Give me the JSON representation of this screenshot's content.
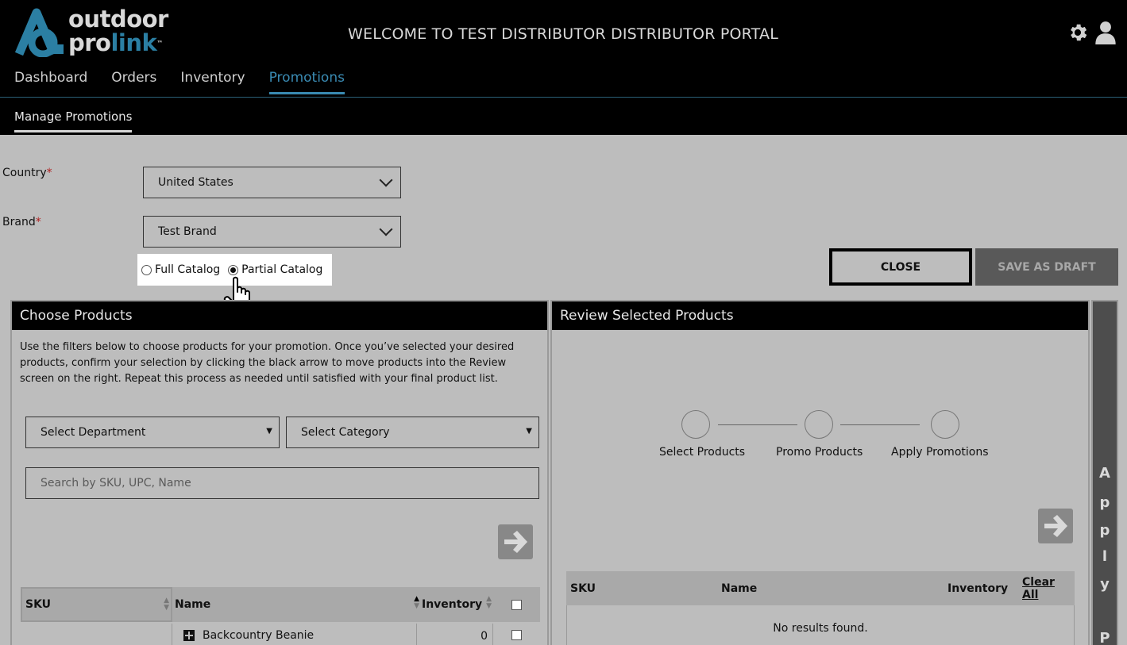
{
  "header": {
    "logo_line1": "outdoor",
    "logo_line2a": "pro",
    "logo_line2b": "link",
    "logo_tm": "™",
    "title": "WELCOME TO TEST DISTRIBUTOR DISTRIBUTOR PORTAL",
    "icons": [
      "gear-icon",
      "user-icon"
    ]
  },
  "nav": {
    "items": [
      {
        "label": "Dashboard",
        "active": false
      },
      {
        "label": "Orders",
        "active": false
      },
      {
        "label": "Inventory",
        "active": false
      },
      {
        "label": "Promotions",
        "active": true
      }
    ]
  },
  "subnav": {
    "label": "Manage Promotions"
  },
  "form": {
    "country_label": "Country",
    "brand_label": "Brand",
    "required_mark": "*",
    "country_value": "United States",
    "brand_value": "Test Brand",
    "catalog_options": [
      {
        "label": "Full Catalog",
        "checked": false
      },
      {
        "label": "Partial Catalog",
        "checked": true
      }
    ]
  },
  "actions": {
    "close_label": "CLOSE",
    "save_draft_label": "SAVE AS DRAFT"
  },
  "choose": {
    "title": "Choose Products",
    "description": "Use the filters below to choose products for your promotion. Once you’ve selected your desired products, confirm your selection by clicking the black arrow to move products into the Review screen on the right. Repeat this process as needed until satisfied with your final product list.",
    "department_placeholder": "Select Department",
    "category_placeholder": "Select Category",
    "search_placeholder": "Search by SKU, UPC, Name",
    "columns": {
      "sku": "SKU",
      "name": "Name",
      "inventory": "Inventory"
    },
    "rows": [
      {
        "sku": "",
        "name": "Backcountry Beanie",
        "inventory": "0"
      }
    ]
  },
  "review": {
    "title": "Review Selected Products",
    "steps": [
      "Select Products",
      "Promo Products",
      "Apply Promotions"
    ],
    "columns": {
      "sku": "SKU",
      "name": "Name",
      "inventory": "Inventory",
      "clear": "Clear All"
    },
    "empty_text": "No results found."
  },
  "apply_bar": {
    "letters": [
      "A",
      "p",
      "p",
      "l",
      "y",
      "P"
    ]
  },
  "colors": {
    "accent": "#3a8bb3",
    "logo_teal": "#2b7fa3",
    "header_bg": "#000000",
    "page_bg": "#bdbdbd",
    "required": "#b02020"
  }
}
